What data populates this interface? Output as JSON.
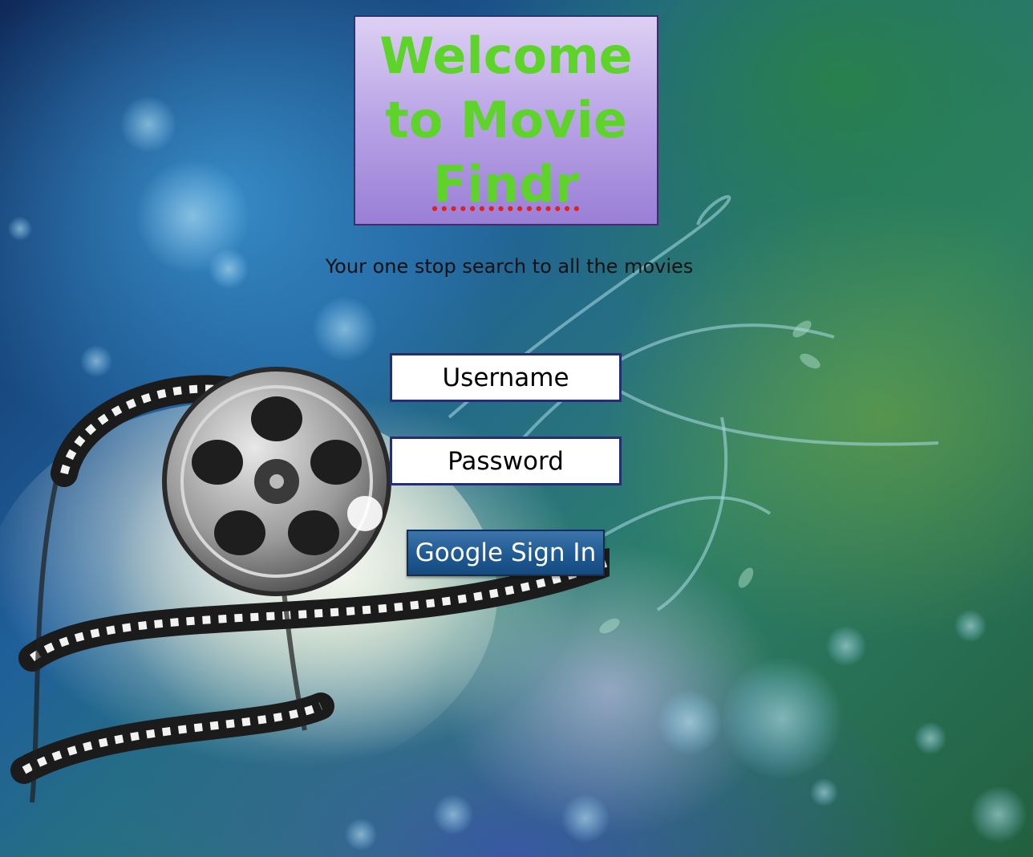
{
  "title": {
    "line1": "Welcome",
    "line2": "to Movie",
    "line3": "Findr"
  },
  "tagline": "Your one stop search to all the movies",
  "login": {
    "username_placeholder": "Username",
    "password_placeholder": "Password",
    "google_button_label": "Google Sign In"
  },
  "colors": {
    "title_text": "#5ed42a",
    "title_box": "#b9a3e6",
    "field_border": "#24306b",
    "button_bg": "#1f5a93"
  }
}
